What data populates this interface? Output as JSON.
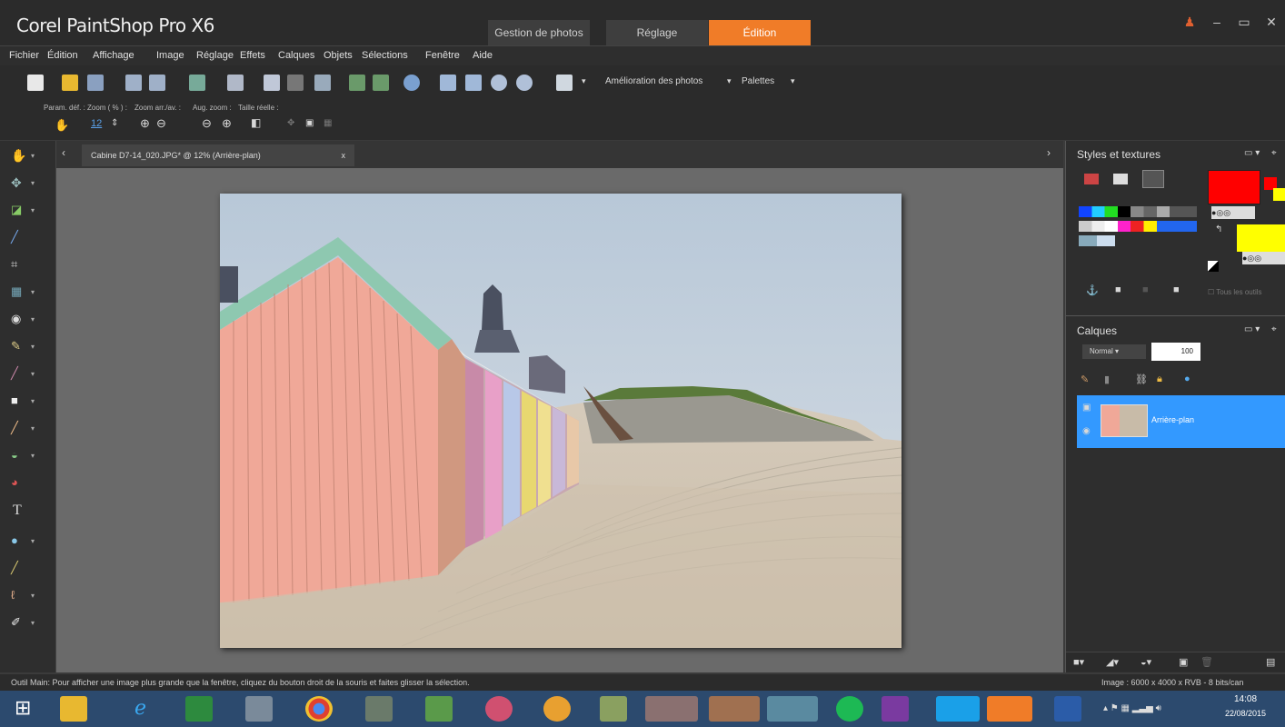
{
  "window": {
    "title": "Corel PaintShop Pro X6",
    "tabs": [
      "Gestion de photos",
      "Réglage",
      "Édition"
    ],
    "active_tab": "Édition"
  },
  "menu": [
    "Fichier",
    "Édition",
    "Affichage",
    "Image",
    "Réglage",
    "Effets",
    "Calques",
    "Objets",
    "Sélections",
    "Fenêtre",
    "Aide"
  ],
  "toolbar": {
    "enhance": "Amélioration des photos",
    "palettes": "Palettes"
  },
  "tool_options": {
    "preset": "Param. déf. :",
    "zoom_pct": "Zoom ( % ) :",
    "zoom_value": "12",
    "zoom_inout": "Zoom arr./av. :",
    "zoom_step": "Aug. zoom :",
    "actual_size": "Taille réelle :"
  },
  "document": {
    "tab_label": "Cabine D7-14_020.JPG* @ 12% (Arrière-plan)",
    "close": "x"
  },
  "styles_panel": {
    "title": "Styles et textures",
    "all_tools": "Tous les outils"
  },
  "layers_panel": {
    "title": "Calques",
    "blend_mode": "Normal",
    "opacity": "100",
    "layer_name": "Arrière-plan"
  },
  "status": {
    "hint": "Outil Main: Pour afficher une image plus grande que la fenêtre, cliquez du bouton droit de la souris et faites glisser la sélection.",
    "image_info": "Image : 6000 x 4000 x RVB - 8 bits/can"
  },
  "taskbar": {
    "time": "14:08",
    "date": "22/08/2015"
  },
  "colors": {
    "accent": "#f07c28",
    "fg": "#ff0000",
    "bg": "#ffff00",
    "layer_selected": "#3399ff"
  }
}
